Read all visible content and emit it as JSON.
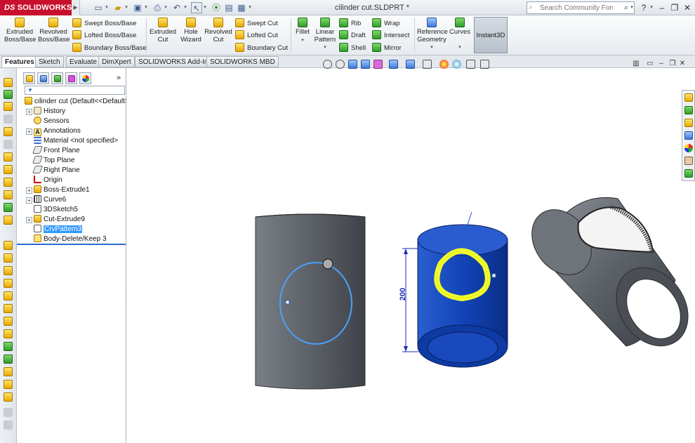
{
  "titlebar": {
    "app_name": "SOLIDWORKS",
    "app_prefix": "DS",
    "doc_title": "cilinder cut.SLDPRT *",
    "search_placeholder": "Search Community Forum",
    "help_label": "?",
    "icons": [
      "new-icon",
      "open-icon",
      "save-icon",
      "print-icon",
      "undo-icon",
      "select-icon",
      "rebuild-icon",
      "options-icon"
    ]
  },
  "command_manager": {
    "extruded_boss": "Extruded Boss/Base",
    "revolved_boss": "Revolved Boss/Base",
    "swept_boss": "Swept Boss/Base",
    "lofted_boss": "Lofted Boss/Base",
    "boundary_boss": "Boundary Boss/Base",
    "extruded_cut": "Extruded Cut",
    "hole_wizard": "Hole Wizard",
    "revolved_cut": "Revolved Cut",
    "swept_cut": "Swept Cut",
    "lofted_cut": "Lofted Cut",
    "boundary_cut": "Boundary Cut",
    "fillet": "Fillet",
    "linear_pattern": "Linear Pattern",
    "rib": "Rib",
    "draft": "Draft",
    "shell": "Shell",
    "wrap": "Wrap",
    "intersect": "Intersect",
    "mirror": "Mirror",
    "reference_geometry": "Reference Geometry",
    "curves": "Curves",
    "instant3d": "Instant3D"
  },
  "tabs": [
    "Features",
    "Sketch",
    "Evaluate",
    "DimXpert",
    "SOLIDWORKS Add-Ins",
    "SOLIDWORKS MBD"
  ],
  "feature_tree": {
    "root": "cilinder cut  (Default<<Default>",
    "items": [
      {
        "label": "History",
        "expandable": true
      },
      {
        "label": "Sensors",
        "expandable": false
      },
      {
        "label": "Annotations",
        "expandable": true
      },
      {
        "label": "Material <not specified>",
        "expandable": false
      },
      {
        "label": "Front Plane",
        "expandable": false
      },
      {
        "label": "Top Plane",
        "expandable": false
      },
      {
        "label": "Right Plane",
        "expandable": false
      },
      {
        "label": "Origin",
        "expandable": false
      },
      {
        "label": "Boss-Extrude1",
        "expandable": true
      },
      {
        "label": "Curve6",
        "expandable": true
      },
      {
        "label": "3DSketch5",
        "expandable": false
      },
      {
        "label": "Cut-Extrude9",
        "expandable": true
      },
      {
        "label": "CrvPattern3",
        "expandable": false,
        "selected": true
      },
      {
        "label": "Body-Delete/Keep 3",
        "expandable": false
      }
    ]
  },
  "viewport": {
    "dimension_value": "200"
  },
  "colors": {
    "brand_red": "#c8102e",
    "model_gray": "#5f646b",
    "model_blue": "#1040b0",
    "highlight_yellow": "#f2ff2a",
    "sketch_blue": "#3d8fe8",
    "selection_blue": "#3399ff"
  }
}
